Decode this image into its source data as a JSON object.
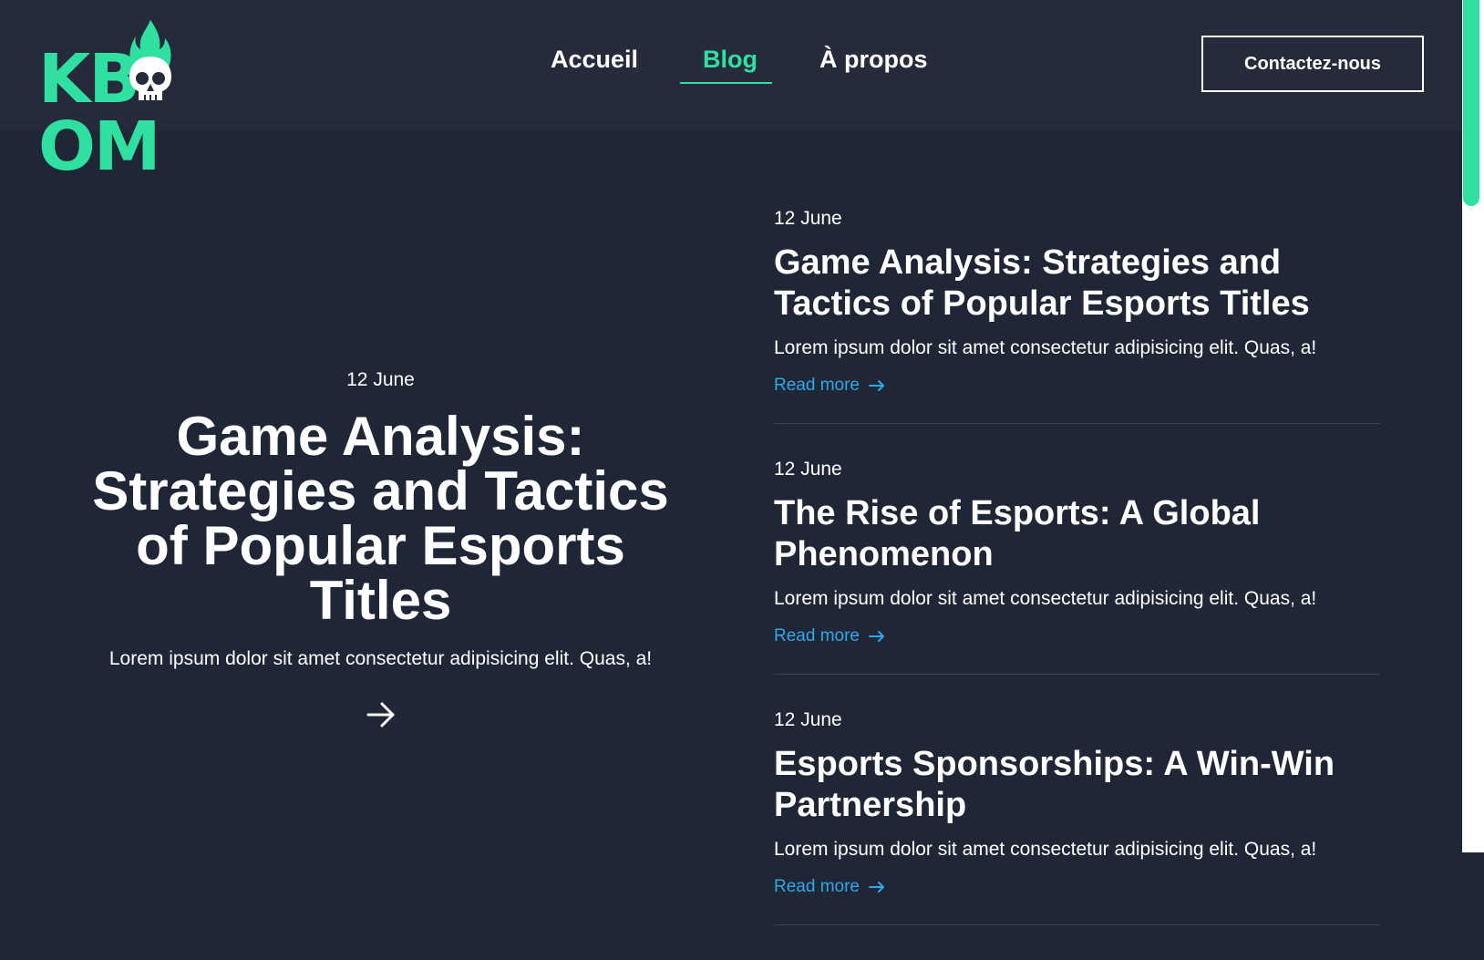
{
  "brand": {
    "name": "KBOOM",
    "accent": "#2fe0a0",
    "link_color": "#2fa8e8"
  },
  "nav": {
    "items": [
      {
        "label": "Accueil"
      },
      {
        "label": "Blog",
        "active": true
      },
      {
        "label": "À propos"
      }
    ],
    "contact_label": "Contactez-nous"
  },
  "featured": {
    "date": "12 June",
    "title": "Game Analysis: Strategies and Tactics of Popular Esports Titles",
    "excerpt": "Lorem ipsum dolor sit amet consectetur adipisicing elit. Quas, a!"
  },
  "posts": [
    {
      "date": "12 June",
      "title": "Game Analysis: Strategies and Tactics of Popular Esports Titles",
      "excerpt": "Lorem ipsum dolor sit amet consectetur adipisicing elit. Quas, a!",
      "link": "Read more"
    },
    {
      "date": "12 June",
      "title": "The Rise of Esports: A Global Phenomenon",
      "excerpt": "Lorem ipsum dolor sit amet consectetur adipisicing elit. Quas, a!",
      "link": "Read more"
    },
    {
      "date": "12 June",
      "title": "Esports Sponsorships: A Win-Win Partnership",
      "excerpt": "Lorem ipsum dolor sit amet consectetur adipisicing elit. Quas, a!",
      "link": "Read more"
    }
  ]
}
